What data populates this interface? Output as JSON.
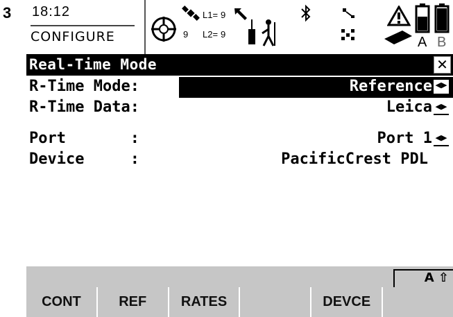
{
  "step_number": "3",
  "status": {
    "time": "18:12",
    "mode": "CONFIGURE",
    "sat_count": "9",
    "l1_label": "L1=",
    "l1_value": "9",
    "l2_label": "L2=",
    "l2_value": "9",
    "battery_labels": [
      "A",
      "B"
    ]
  },
  "dialog": {
    "title": "Real-Time Mode",
    "close_label": "✕"
  },
  "fields": [
    {
      "label": "R-Time Mode:",
      "value": "Reference",
      "has_list": true
    },
    {
      "label": "R-Time Data:",
      "value": "Leica",
      "has_list": true
    },
    {
      "label": "Port       :",
      "value": "Port 1",
      "has_list": true
    },
    {
      "label": "Device     :",
      "value": "PacificCrest PDL",
      "has_list": false
    }
  ],
  "list_arrows": "◀▶",
  "shift_indicator": "A ⇧",
  "softkeys": [
    "CONT",
    "REF",
    "RATES",
    "",
    "DEVCE",
    ""
  ]
}
